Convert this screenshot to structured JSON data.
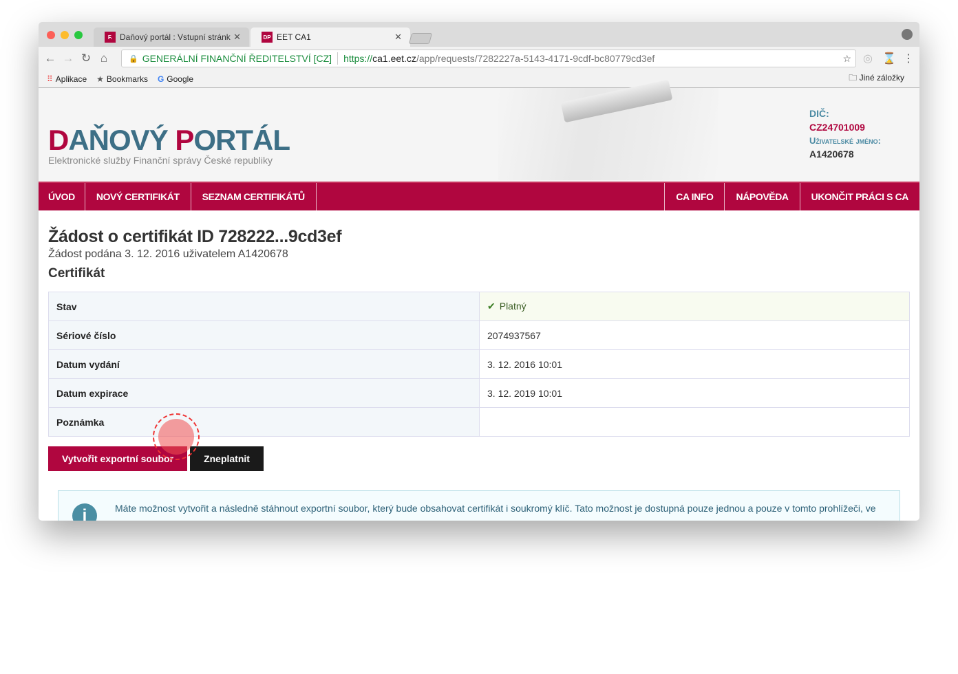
{
  "browser": {
    "tabs": [
      {
        "label": "Daňový portál :  Vstupní stránk",
        "favicon": "F."
      },
      {
        "label": "EET CA1",
        "favicon": "DP"
      }
    ],
    "security_label": "GENERÁLNÍ FINANČNÍ ŘEDITELSTVÍ [CZ]",
    "url_scheme": "https://",
    "url_host": "ca1.eet.cz",
    "url_path": "/app/requests/7282227a-5143-4171-9cdf-bc80779cd3ef",
    "bookmarks": [
      "Aplikace",
      "Bookmarks",
      "Google"
    ],
    "other_bookmarks": "Jiné záložky"
  },
  "header": {
    "logo_part1": "DAŇOVÝ ",
    "logo_part2": "PORTÁL",
    "logo_r1": "D",
    "logo_r2": "P",
    "subtitle": "Elektronické služby Finanční správy České republiky",
    "dic_label": "DIČ:",
    "dic": "CZ24701009",
    "user_label": "Uživatelské jméno:",
    "user": "A1420678"
  },
  "nav": {
    "left": [
      "ÚVOD",
      "NOVÝ CERTIFIKÁT",
      "SEZNAM CERTIFIKÁTŮ"
    ],
    "right": [
      "CA INFO",
      "NÁPOVĚDA",
      "UKONČIT PRÁCI S CA"
    ]
  },
  "main": {
    "title": "Žádost o certifikát ID 728222...9cd3ef",
    "meta": "Žádost podána 3. 12. 2016 uživatelem A1420678",
    "section": "Certifikát",
    "rows": [
      {
        "k": "Stav",
        "v": "Platný"
      },
      {
        "k": "Sériové číslo",
        "v": "2074937567"
      },
      {
        "k": "Datum vydání",
        "v": "3. 12. 2016 10:01"
      },
      {
        "k": "Datum expirace",
        "v": "3. 12. 2019 10:01"
      },
      {
        "k": "Poznámka",
        "v": ""
      }
    ],
    "export_button": "Vytvořit exportní soubor",
    "revoke_button": "Zneplatnit",
    "alert": "Máte možnost vytvořit a následně stáhnout exportní soubor, který bude obsahovat certifikát i soukromý klíč. Tato možnost je dostupná pouze jednou a pouze v tomto prohlížeči, ve"
  },
  "colors": {
    "brand": "#b0063f",
    "accent": "#3d6f86",
    "valid": "#3a5d23"
  }
}
